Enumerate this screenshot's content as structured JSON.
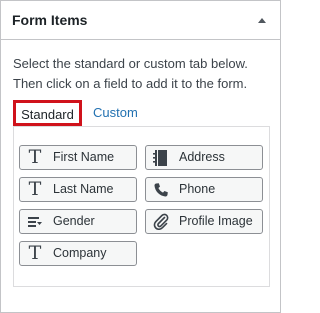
{
  "panel": {
    "title": "Form Items",
    "collapse_icon": "triangle-up-icon"
  },
  "instructions": {
    "line1": "Select the standard or custom tab below.",
    "line2": "Then click on a field to add it to the form."
  },
  "tabs": {
    "standard": "Standard",
    "custom": "Custom"
  },
  "colors": {
    "highlight_border": "#d0121b",
    "link": "#2271b1"
  },
  "fields": [
    {
      "label": "First Name",
      "icon": "text-T-icon"
    },
    {
      "label": "Address",
      "icon": "address-book-icon"
    },
    {
      "label": "Last Name",
      "icon": "text-T-icon"
    },
    {
      "label": "Phone",
      "icon": "phone-icon"
    },
    {
      "label": "Gender",
      "icon": "dropdown-list-icon"
    },
    {
      "label": "Profile Image",
      "icon": "paperclip-icon"
    },
    {
      "label": "Company",
      "icon": "text-T-icon"
    }
  ]
}
